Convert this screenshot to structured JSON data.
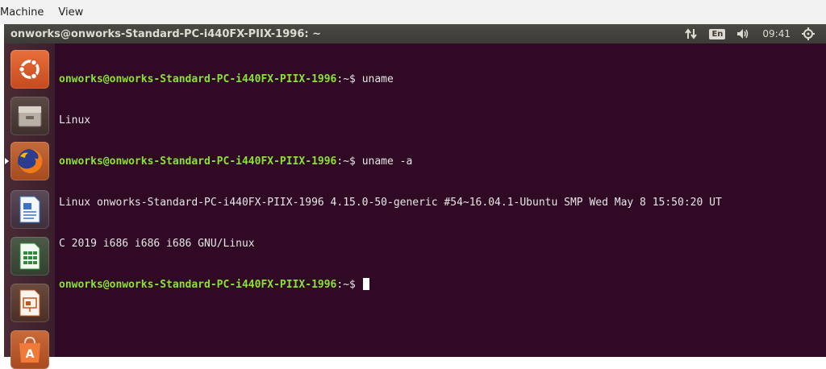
{
  "vm_menu": {
    "items": [
      {
        "label": "Machine"
      },
      {
        "label": "View"
      }
    ]
  },
  "panel": {
    "window_title": "onworks@onworks-Standard-PC-i440FX-PIIX-1996: ~",
    "language": "En",
    "clock": "09:41",
    "indicators": [
      "network-icon",
      "keyboard-language-icon",
      "volume-icon",
      "power-gear-icon"
    ]
  },
  "launcher": {
    "items": [
      {
        "name": "ubuntu-dash-icon",
        "color": "#d9542a"
      },
      {
        "name": "files-icon",
        "color": "#8a7f72"
      },
      {
        "name": "firefox-icon",
        "color": "#e66000"
      },
      {
        "name": "writer-icon",
        "color": "#3a75c4"
      },
      {
        "name": "calc-icon",
        "color": "#2e8b3a"
      },
      {
        "name": "impress-icon",
        "color": "#c2561b"
      },
      {
        "name": "software-center-icon",
        "color": "#e0622c"
      }
    ]
  },
  "terminal": {
    "prompt_user_host": "onworks@onworks-Standard-PC-i440FX-PIIX-1996",
    "prompt_path": ":~$ ",
    "lines": [
      {
        "type": "prompt",
        "command": "uname"
      },
      {
        "type": "output",
        "text": "Linux"
      },
      {
        "type": "prompt",
        "command": "uname -a"
      },
      {
        "type": "output",
        "text": "Linux onworks-Standard-PC-i440FX-PIIX-1996 4.15.0-50-generic #54~16.04.1-Ubuntu SMP Wed May 8 15:50:20 UT"
      },
      {
        "type": "output",
        "text": "C 2019 i686 i686 i686 GNU/Linux"
      },
      {
        "type": "prompt",
        "command": ""
      }
    ]
  },
  "colors": {
    "terminal_bg": "#300a24",
    "prompt_green": "#8ae234",
    "panel_bg": "#3c3b37"
  }
}
